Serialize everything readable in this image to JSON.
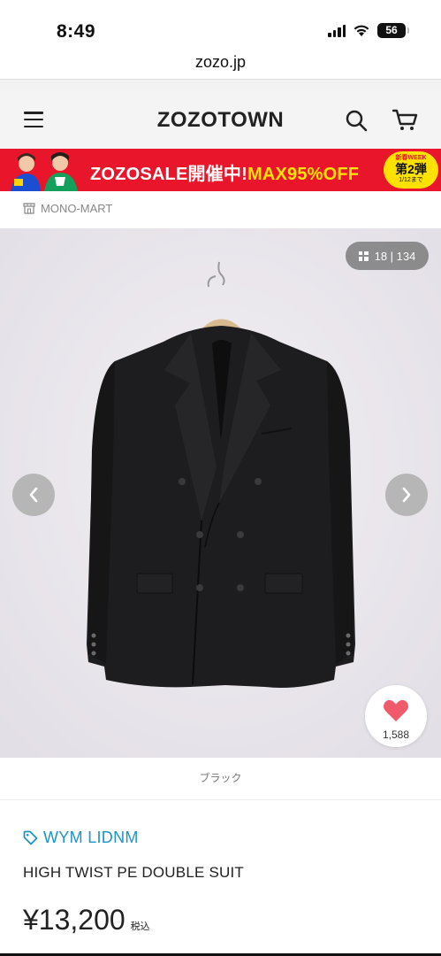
{
  "status_bar": {
    "time": "8:49",
    "battery": "56",
    "icons": [
      "signal-icon",
      "wifi-icon",
      "battery-icon"
    ]
  },
  "browser": {
    "url": "zozo.jp"
  },
  "header": {
    "logo": "ZOZOTOWN",
    "icons": [
      "menu-icon",
      "search-icon",
      "cart-icon"
    ]
  },
  "banner": {
    "text_main": "ZOZOSALE開催中!",
    "text_accent": "MAX95%OFF",
    "badge_top": "新春WEEK",
    "badge_mid": "第2弾",
    "badge_bottom": "1/12まで",
    "colors": {
      "background": "#e8152b",
      "accent": "#ffe500",
      "badge": "#ffe100"
    }
  },
  "shop": {
    "name": "MONO-MART",
    "icon": "store-icon"
  },
  "gallery": {
    "counter": "18 | 134",
    "prev_icon": "chevron-left-icon",
    "next_icon": "chevron-right-icon"
  },
  "favorite": {
    "count": "1,588",
    "icon": "heart-icon",
    "color": "#ef5b6b"
  },
  "product": {
    "color_name": "ブラック",
    "brand": "WYM LIDNM",
    "brand_icon": "tag-icon",
    "brand_color": "#1f93c8",
    "name": "HIGH TWIST PE DOUBLE SUIT",
    "price": "¥13,200",
    "tax_label": "税込"
  }
}
